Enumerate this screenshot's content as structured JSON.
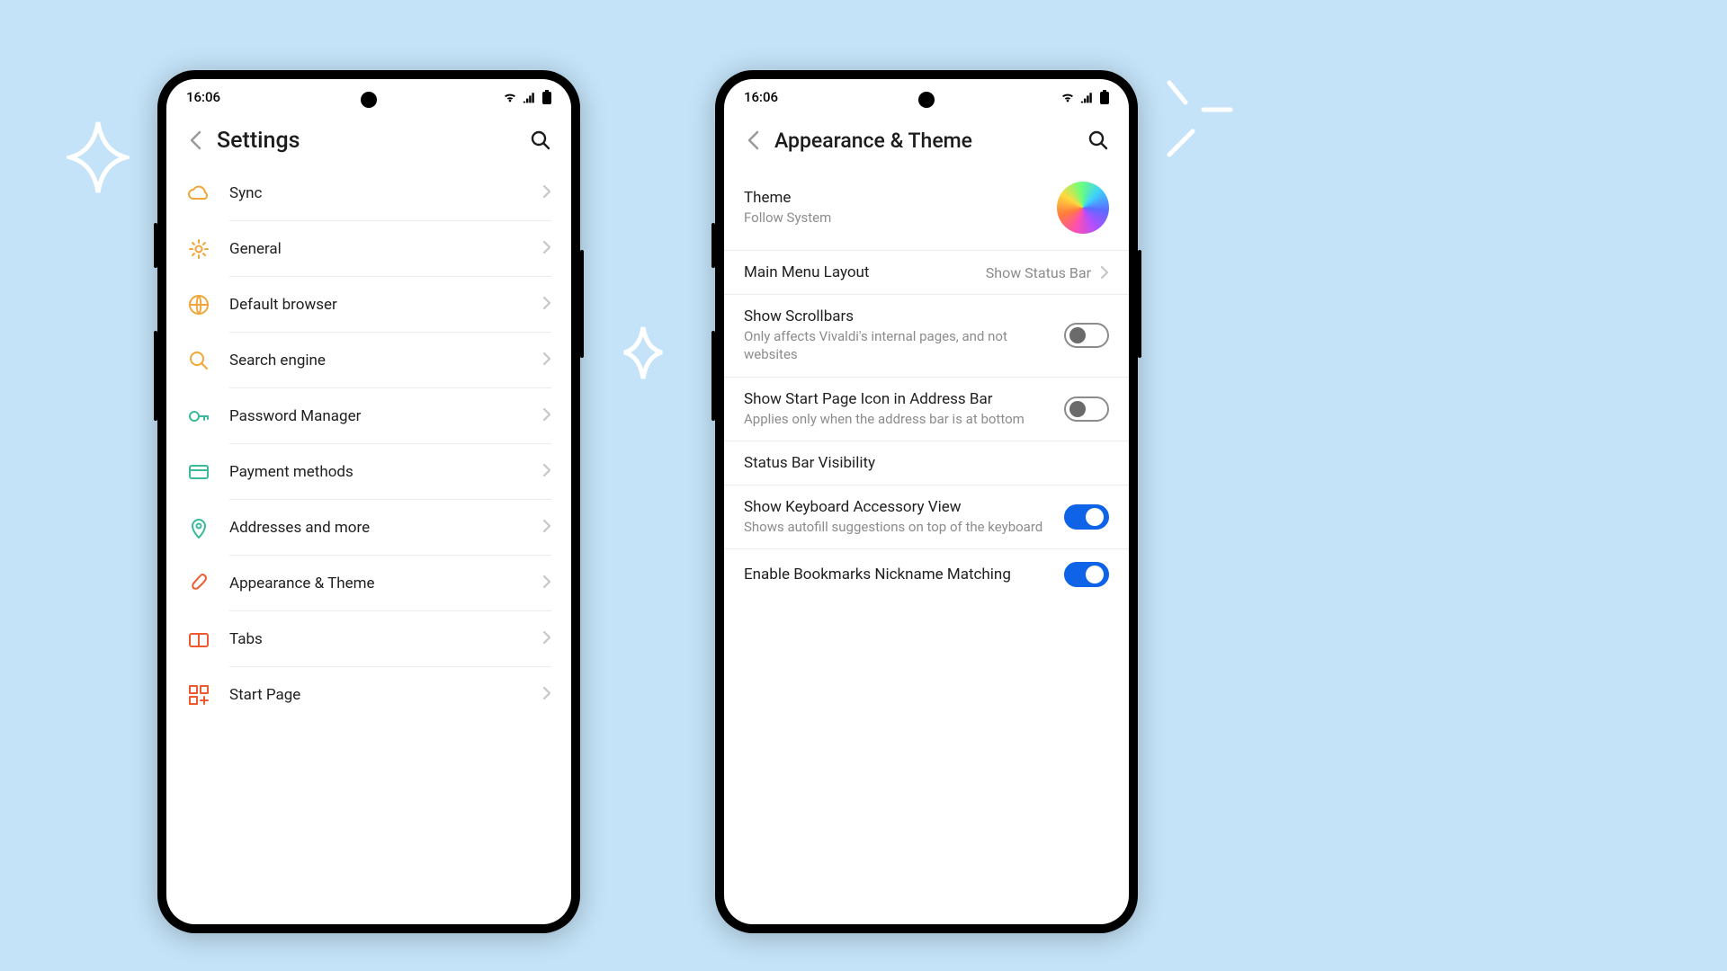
{
  "status": {
    "time": "16:06"
  },
  "left": {
    "title": "Settings",
    "items": [
      {
        "name": "sync",
        "label": "Sync",
        "icon": "cloud",
        "color": "#f2a63a"
      },
      {
        "name": "general",
        "label": "General",
        "icon": "gear",
        "color": "#f2a63a"
      },
      {
        "name": "browser",
        "label": "Default browser",
        "icon": "globe",
        "color": "#f2a63a"
      },
      {
        "name": "search",
        "label": "Search engine",
        "icon": "search",
        "color": "#f2a63a"
      },
      {
        "name": "passwords",
        "label": "Password Manager",
        "icon": "key",
        "color": "#3bb99b"
      },
      {
        "name": "payment",
        "label": "Payment methods",
        "icon": "card",
        "color": "#3bb99b"
      },
      {
        "name": "addresses",
        "label": "Addresses and more",
        "icon": "pin",
        "color": "#3bb99b"
      },
      {
        "name": "appearance",
        "label": "Appearance & Theme",
        "icon": "brush",
        "color": "#ee5a2f"
      },
      {
        "name": "tabs",
        "label": "Tabs",
        "icon": "tabs",
        "color": "#ee5a2f"
      },
      {
        "name": "startpage",
        "label": "Start Page",
        "icon": "grid",
        "color": "#ee5a2f"
      }
    ]
  },
  "right": {
    "title": "Appearance & Theme",
    "theme": {
      "label": "Theme",
      "value": "Follow System"
    },
    "layout": {
      "label": "Main Menu Layout",
      "value": "Show Status Bar"
    },
    "scrollbars": {
      "label": "Show Scrollbars",
      "sub": "Only affects Vivaldi's internal pages, and not websites",
      "on": false
    },
    "startpage_icon": {
      "label": "Show Start Page Icon in Address Bar",
      "sub": "Applies only when the address bar is at bottom",
      "on": false
    },
    "statusbar_vis": {
      "label": "Status Bar Visibility"
    },
    "keyboard_acc": {
      "label": "Show Keyboard Accessory View",
      "sub": "Shows autofill suggestions on top of the keyboard",
      "on": true
    },
    "bookmarks_nick": {
      "label": "Enable Bookmarks Nickname Matching",
      "on": true
    }
  }
}
